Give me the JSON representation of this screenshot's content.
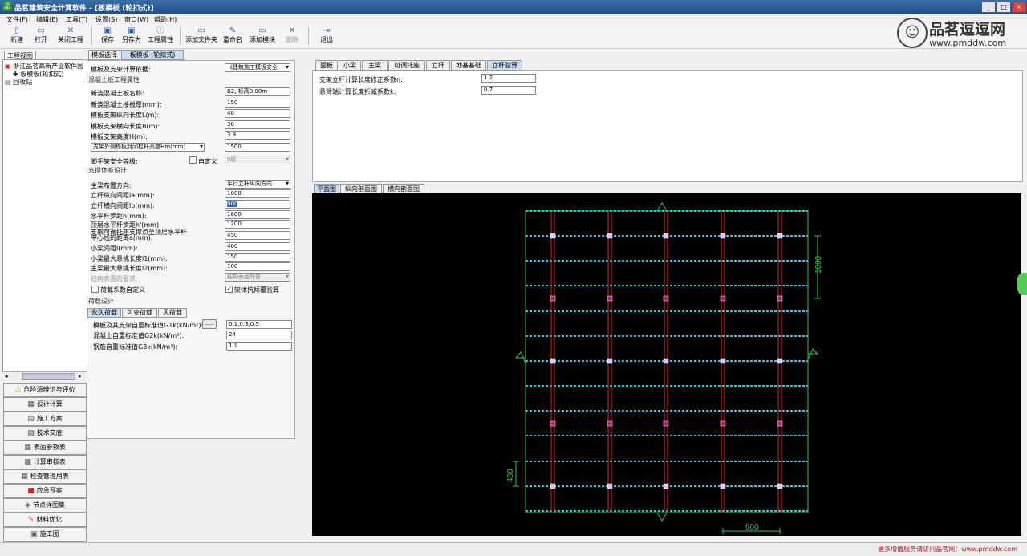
{
  "window": {
    "title": "品茗建筑安全计算软件 - [板模板 (轮扣式)]"
  },
  "menu": [
    "文件(F)",
    "编辑(E)",
    "工具(T)",
    "设置(S)",
    "窗口(W)",
    "帮助(H)"
  ],
  "toolbar": {
    "buttons": [
      "新建",
      "打开",
      "关闭工程",
      "保存",
      "另存为",
      "工程属性",
      "添加文件夹",
      "重命名",
      "添加模块",
      "删除",
      "退出"
    ]
  },
  "watermark": {
    "brand": "品茗逗逗网",
    "url": "www.pmddw.com"
  },
  "left": {
    "tab": "工程视图",
    "tree": [
      "浙江品茗高新产业软件园",
      "板模板(轮扣式)",
      "回收站"
    ],
    "nav": [
      "危险源辨识与评价",
      "设计计算",
      "施工方案",
      "技术交底",
      "表面参数表",
      "计算审核表",
      "检查管理用表",
      "应急预案",
      "节点详图集",
      "材料优化",
      "施工图"
    ]
  },
  "form": {
    "tabs": [
      "模板选择",
      "板模板 (轮扣式)"
    ],
    "basis_label": "模板及支架计算依据:",
    "basis_value": "《建筑施工模板安全",
    "section_concrete": "混凝土板工程属性",
    "concrete_rows": [
      {
        "label": "新浇混凝土板名称:",
        "value": "B2, 标高0.00m"
      },
      {
        "label": "新浇混凝土楼板厚(mm):",
        "value": "150"
      },
      {
        "label": "模板支架纵向长度L(m):",
        "value": "40"
      },
      {
        "label": "模板支架横向长度B(m):",
        "value": "30"
      },
      {
        "label": "模板支架高度H(m):",
        "value": "3.9"
      }
    ],
    "ext_label": "支架外侧模板封闭栏杆高度Hm(mm)",
    "ext_value": "1500",
    "safety_label": "脚手架安全等级:",
    "safety_custom": "自定义",
    "safety_value": "II级",
    "section_support": "支撑体系设计",
    "support_rows": [
      {
        "label": "主梁布置方向:",
        "value": "平行立杆纵向方向"
      },
      {
        "label": "立杆纵向间距la(mm):",
        "value": "1000"
      },
      {
        "label": "立杆横向间距lb(mm):",
        "value": "900"
      },
      {
        "label": "水平杆步距h(mm):",
        "value": "1800"
      },
      {
        "label": "顶层水平杆步距h'(mm):",
        "value": "1200"
      },
      {
        "label": "支架可调托座支撑点至顶层水平杆中心线的距离a(mm):",
        "value": "450"
      },
      {
        "label": "小梁间距l(mm):",
        "value": "400"
      },
      {
        "label": "小梁最大悬挑长度l1(mm):",
        "value": "150"
      },
      {
        "label": "主梁最大悬挑长度l2(mm):",
        "value": "100"
      },
      {
        "label": "结构表面的要求:",
        "value": "结构表面外露"
      }
    ],
    "check_load": "荷载系数自定义",
    "check_frame": "架体抗倾覆验算",
    "section_load": "荷载设计",
    "load_tabs": [
      "永久荷载",
      "可变荷载",
      "风荷载"
    ],
    "load_rows": [
      {
        "label": "模板及其支架自重标准值G1k(kN/m²):",
        "value": "0.1,0.3,0.5"
      },
      {
        "label": "混凝土自重标准值G2k(kN/m³):",
        "value": "24"
      },
      {
        "label": "钢筋自重标准值G3k(kN/m³):",
        "value": "1.1"
      }
    ],
    "ellipsis": "......"
  },
  "right": {
    "tabs": [
      "面板",
      "小梁",
      "主梁",
      "可调托座",
      "立杆",
      "地基基础",
      "立杆验算"
    ],
    "rows": [
      {
        "label": "支架立杆计算长度修正系数η:",
        "value": "1.2"
      },
      {
        "label": "悬臂端计算长度折减系数k:",
        "value": "0.7"
      }
    ],
    "drawing_tabs": [
      "平面图",
      "纵向剖面图",
      "横向剖面图"
    ]
  },
  "drawing": {
    "dim_right": "1000",
    "dim_left": "400",
    "dim_bottom": "900"
  },
  "status": {
    "message": "更多增值服务请访问品茗网：www.pmddw.com"
  }
}
